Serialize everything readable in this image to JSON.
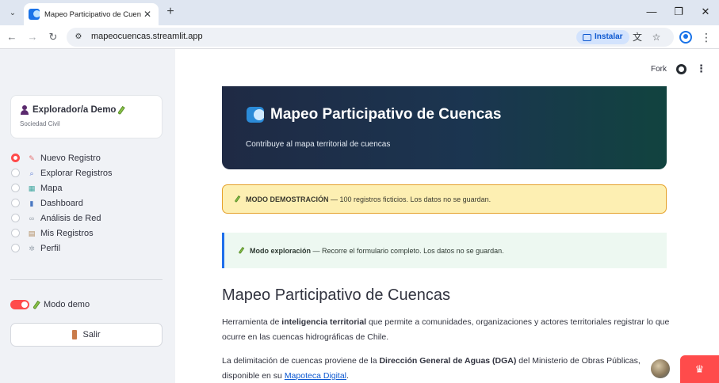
{
  "browser": {
    "tab_title": "Mapeo Participativo de Cuencas",
    "url": "mapeocuencas.streamlit.app",
    "install_label": "Instalar",
    "tab_dropdown_glyph": "⌄",
    "close_glyph": "✕",
    "new_tab_glyph": "+",
    "minimize_glyph": "—",
    "maximize_glyph": "❐",
    "window_close_glyph": "✕",
    "back_glyph": "←",
    "forward_glyph": "→",
    "reload_glyph": "↻",
    "site_glyph": "⚙",
    "translate_glyph": "⽂",
    "star_glyph": "☆",
    "menu_glyph": "⋮"
  },
  "sidebar": {
    "user_name": "Explorador/a Demo",
    "user_role": "Sociedad Civil",
    "nav_items": [
      {
        "label": "Nuevo Registro",
        "icon": "memo-icon",
        "color": "#e57373",
        "selected": true
      },
      {
        "label": "Explorar Registros",
        "icon": "magnifier-icon",
        "color": "#5b7bd5",
        "selected": false
      },
      {
        "label": "Mapa",
        "icon": "map-icon",
        "color": "#3fa7a0",
        "selected": false
      },
      {
        "label": "Dashboard",
        "icon": "bar-chart-icon",
        "color": "#4a78c2",
        "selected": false
      },
      {
        "label": "Análisis de Red",
        "icon": "link-icon",
        "color": "#9aa3ad",
        "selected": false
      },
      {
        "label": "Mis Registros",
        "icon": "clipboard-icon",
        "color": "#b08b5e",
        "selected": false
      },
      {
        "label": "Perfil",
        "icon": "gear-icon",
        "color": "#9aa3ad",
        "selected": false
      }
    ],
    "demo_toggle_label": "Modo demo",
    "demo_toggle_on": true,
    "logout_label": "Salir"
  },
  "header": {
    "fork_label": "Fork",
    "kebab_glyph": "⋮"
  },
  "hero": {
    "title": "Mapeo Participativo de Cuencas",
    "subtitle": "Contribuye al mapa territorial de cuencas"
  },
  "demo_banner": {
    "strong": "MODO DEMOSTRACIÓN",
    "text": " — 100 registros ficticios. Los datos no se guardan."
  },
  "exploration_banner": {
    "strong": "Modo exploración",
    "text": " — Recorre el formulario completo. Los datos no se guardan."
  },
  "content": {
    "heading": "Mapeo Participativo de Cuencas",
    "p1_before": "Herramienta de ",
    "p1_strong": "inteligencia territorial",
    "p1_after": " que permite a comunidades, organizaciones y actores territoriales registrar lo que ocurre en las cuencas hidrográficas de Chile.",
    "p2_before": "La delimitación de cuencas proviene de la ",
    "p2_strong": "Dirección General de Aguas (DGA)",
    "p2_middle": " del Ministerio de Obras Públicas, disponible en su ",
    "p2_link": "Mapoteca Digital",
    "p2_after": "."
  },
  "colors": {
    "accent": "#ff4b4b",
    "sidebar_bg": "#f0f2f6",
    "warning_bg": "#fdefb2",
    "warning_border": "#e5a12a",
    "info_bg": "#edf8f1",
    "info_border": "#1f6feb",
    "hero_start": "#1f2a44",
    "hero_end": "#11433f"
  },
  "badge": {
    "crown_glyph": "♛"
  }
}
